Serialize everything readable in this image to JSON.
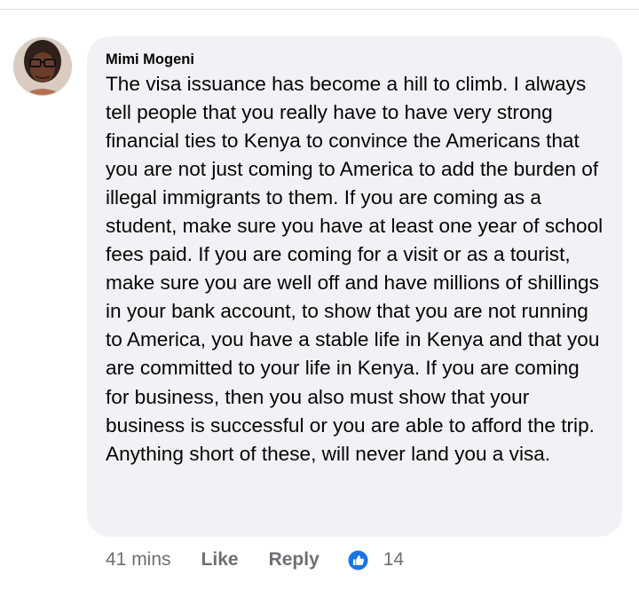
{
  "comment": {
    "author": "Mimi Mogeni",
    "text": "The visa issuance has become a hill to climb. I always tell people that you really have to have very strong financial ties to Kenya to convince the Americans that you are not just coming to America to add the burden of illegal immigrants to them. If you are coming as a student, make sure you have at least one year of school fees paid. If you are coming for a visit or as a tourist, make sure you are well off and have millions of shillings in your bank account, to show that you are not running to America, you have a stable life in Kenya and that you are committed to your life in Kenya. If you are coming for business, then you also must show that your business is successful or you are able to afford the trip. Anything short of these, will never land you a visa.",
    "timestamp": "41 mins",
    "like_label": "Like",
    "reply_label": "Reply",
    "reaction_icon": "thumbs-up-icon",
    "reaction_count": "14"
  },
  "colors": {
    "bubble_background": "#f0f2f5",
    "author_text": "#050505",
    "meta_text": "#6d6f74",
    "like_blue": "#1b74e4"
  }
}
